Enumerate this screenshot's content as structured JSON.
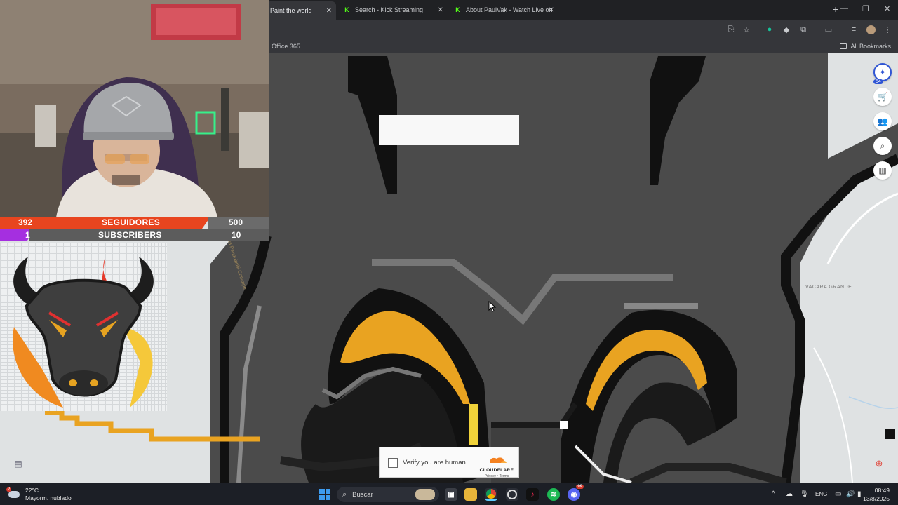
{
  "browser": {
    "tabs": [
      {
        "title": "Paint the world",
        "active": true,
        "favicon": "wplace-icon"
      },
      {
        "title": "Search - Kick Streaming",
        "active": false,
        "favicon": "kick-icon"
      },
      {
        "title": "About PaulVak - Watch Live on",
        "active": false,
        "favicon": "kick-icon"
      }
    ],
    "bookmarks": {
      "first": "Office 365",
      "all": "All Bookmarks"
    }
  },
  "canvas": {
    "place_label": "VACARA GRANDE",
    "road_label": "Ruta Panguipulli-Coñaripe",
    "tool_badge": "54"
  },
  "captcha": {
    "label": "Verify you are human",
    "brand": "CLOUDFLARE",
    "links": "Privacy • Terms"
  },
  "stream": {
    "followers": {
      "count": "392",
      "label": "SEGUIDORES",
      "goal": "500"
    },
    "subscribers": {
      "count": "1",
      "label": "SUBSCRIBERS",
      "goal": "10"
    }
  },
  "taskbar": {
    "weather": {
      "temp": "22°C",
      "condition": "Mayorm. nublado",
      "badge": "2"
    },
    "search_label": "Buscar",
    "language": "ENG",
    "time": "08:49",
    "date": "13/8/2025",
    "discord_badge": "99"
  }
}
